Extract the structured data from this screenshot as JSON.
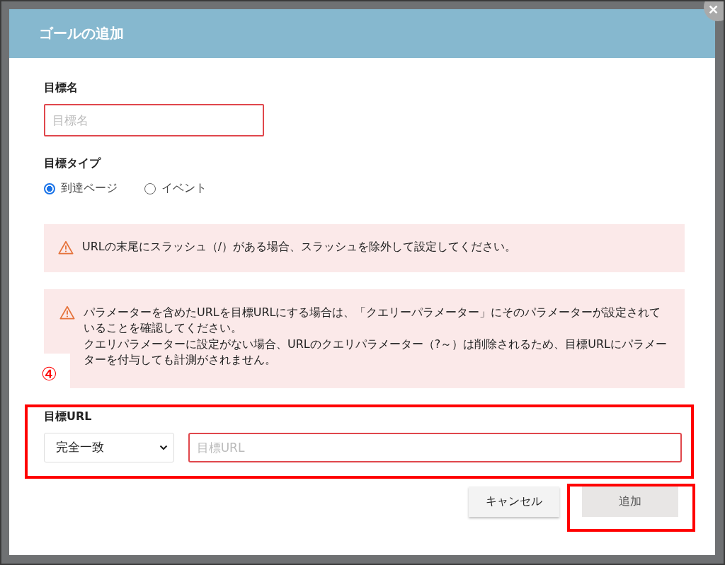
{
  "dialog": {
    "title": "ゴールの追加",
    "close": "✕"
  },
  "goal_name": {
    "label": "目標名",
    "placeholder": "目標名"
  },
  "goal_type": {
    "label": "目標タイプ",
    "options": [
      {
        "label": "到達ページ",
        "selected": true
      },
      {
        "label": "イベント",
        "selected": false
      }
    ]
  },
  "alerts": [
    {
      "lines": [
        "URLの末尾にスラッシュ（/）がある場合、スラッシュを除外して設定してください。"
      ]
    },
    {
      "lines": [
        "パラメーターを含めたURLを目標URLにする場合は、「クエリーパラメーター」にそのパラメーターが設定されていることを確認してください。",
        "クエリパラメーターに設定がない場合、URLのクエリパラメーター（?～）は削除されるため、目標URLにパラメーターを付与しても計測がされません。"
      ]
    }
  ],
  "goal_url": {
    "label": "目標URL",
    "match": "完全一致",
    "placeholder": "目標URL"
  },
  "buttons": [
    {
      "label": "キャンセル",
      "disabled": false
    },
    {
      "label": "追加",
      "disabled": true
    }
  ],
  "annotation": {
    "marker": "④"
  }
}
